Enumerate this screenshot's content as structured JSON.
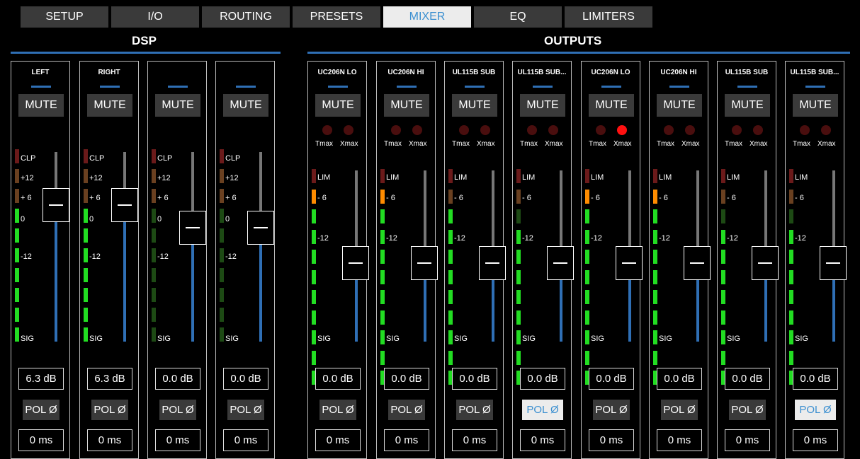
{
  "tabs": [
    {
      "label": "SETUP",
      "active": false
    },
    {
      "label": "I/O",
      "active": false
    },
    {
      "label": "ROUTING",
      "active": false
    },
    {
      "label": "PRESETS",
      "active": false
    },
    {
      "label": "MIXER",
      "active": true
    },
    {
      "label": "EQ",
      "active": false
    },
    {
      "label": "LIMITERS",
      "active": false
    }
  ],
  "sections": {
    "dsp": "DSP",
    "outputs": "OUTPUTS"
  },
  "dsp_strips": [
    {
      "name": "LEFT",
      "gain": "6.3 dB",
      "delay": "0 ms",
      "pol": "POL Ø",
      "pol_on": false,
      "fader_level": 0.72,
      "meter": [
        "dark",
        "dark",
        "dark",
        "green",
        "green",
        "green",
        "green",
        "green",
        "green",
        "green"
      ]
    },
    {
      "name": "RIGHT",
      "gain": "6.3 dB",
      "delay": "0 ms",
      "pol": "POL Ø",
      "pol_on": false,
      "fader_level": 0.72,
      "meter": [
        "dark",
        "dark",
        "dark",
        "green",
        "green",
        "green",
        "green",
        "green",
        "green",
        "green"
      ]
    },
    {
      "name": "",
      "gain": "0.0 dB",
      "delay": "0 ms",
      "pol": "POL Ø",
      "pol_on": false,
      "fader_level": 0.6,
      "meter": [
        "dark",
        "dark",
        "dark",
        "dark",
        "dark",
        "dark",
        "dark",
        "dark",
        "dark",
        "dark"
      ]
    },
    {
      "name": "",
      "gain": "0.0 dB",
      "delay": "0 ms",
      "pol": "POL Ø",
      "pol_on": false,
      "fader_level": 0.6,
      "meter": [
        "dark",
        "dark",
        "dark",
        "dark",
        "dark",
        "dark",
        "dark",
        "dark",
        "dark",
        "dark"
      ]
    }
  ],
  "dsp_meter_labels": [
    "CLP",
    "+12",
    "+ 6",
    "0",
    "-12",
    "SIG"
  ],
  "output_meter_labels": [
    "LIM",
    "- 6",
    "-12",
    "SIG"
  ],
  "led_labels": {
    "tmax": "Tmax",
    "xmax": "Xmax"
  },
  "mute_label": "MUTE",
  "output_strips": [
    {
      "name": "UC206N LO",
      "gain": "0.0 dB",
      "delay": "0 ms",
      "pol": "POL Ø",
      "pol_on": false,
      "xmax_on": false,
      "fader_level": 0.6,
      "meter": [
        "dark",
        "orange",
        "green",
        "green",
        "green",
        "green",
        "green",
        "green",
        "green",
        "green",
        "green"
      ]
    },
    {
      "name": "UC206N HI",
      "gain": "0.0 dB",
      "delay": "0 ms",
      "pol": "POL Ø",
      "pol_on": false,
      "xmax_on": false,
      "fader_level": 0.6,
      "meter": [
        "dark",
        "orange",
        "green",
        "green",
        "green",
        "green",
        "green",
        "green",
        "green",
        "green",
        "green"
      ]
    },
    {
      "name": "UL115B SUB",
      "gain": "0.0 dB",
      "delay": "0 ms",
      "pol": "POL Ø",
      "pol_on": false,
      "xmax_on": false,
      "fader_level": 0.6,
      "meter": [
        "dark",
        "dark",
        "green",
        "green",
        "green",
        "green",
        "green",
        "green",
        "green",
        "green",
        "green"
      ]
    },
    {
      "name": "UL115B SUB...",
      "gain": "0.0 dB",
      "delay": "0 ms",
      "pol": "POL Ø",
      "pol_on": true,
      "xmax_on": false,
      "fader_level": 0.6,
      "meter": [
        "dark",
        "dark",
        "dkgreen",
        "green",
        "green",
        "green",
        "green",
        "green",
        "green",
        "green",
        "green"
      ]
    },
    {
      "name": "UC206N LO",
      "gain": "0.0 dB",
      "delay": "0 ms",
      "pol": "POL Ø",
      "pol_on": false,
      "xmax_on": true,
      "fader_level": 0.6,
      "meter": [
        "dark",
        "orange",
        "green",
        "green",
        "green",
        "green",
        "green",
        "green",
        "green",
        "green",
        "green"
      ]
    },
    {
      "name": "UC206N HI",
      "gain": "0.0 dB",
      "delay": "0 ms",
      "pol": "POL Ø",
      "pol_on": false,
      "xmax_on": false,
      "fader_level": 0.6,
      "meter": [
        "dark",
        "orange",
        "green",
        "green",
        "green",
        "green",
        "green",
        "green",
        "green",
        "green",
        "green"
      ]
    },
    {
      "name": "UL115B SUB",
      "gain": "0.0 dB",
      "delay": "0 ms",
      "pol": "POL Ø",
      "pol_on": false,
      "xmax_on": false,
      "fader_level": 0.6,
      "meter": [
        "dark",
        "dark",
        "dkgreen",
        "green",
        "green",
        "green",
        "green",
        "green",
        "green",
        "green",
        "green"
      ]
    },
    {
      "name": "UL115B SUB...",
      "gain": "0.0 dB",
      "delay": "0 ms",
      "pol": "POL Ø",
      "pol_on": true,
      "xmax_on": false,
      "fader_level": 0.6,
      "meter": [
        "dark",
        "dark",
        "dkgreen",
        "green",
        "green",
        "green",
        "green",
        "green",
        "green",
        "green",
        "green"
      ]
    }
  ],
  "colors": {
    "accent": "#2f6fb5",
    "meter_green": "#22dd22",
    "meter_dark": "#1d4a14",
    "meter_orange": "#ff8c00",
    "meter_clip": "#6b1a1a",
    "meter_brown": "#6a4020"
  }
}
